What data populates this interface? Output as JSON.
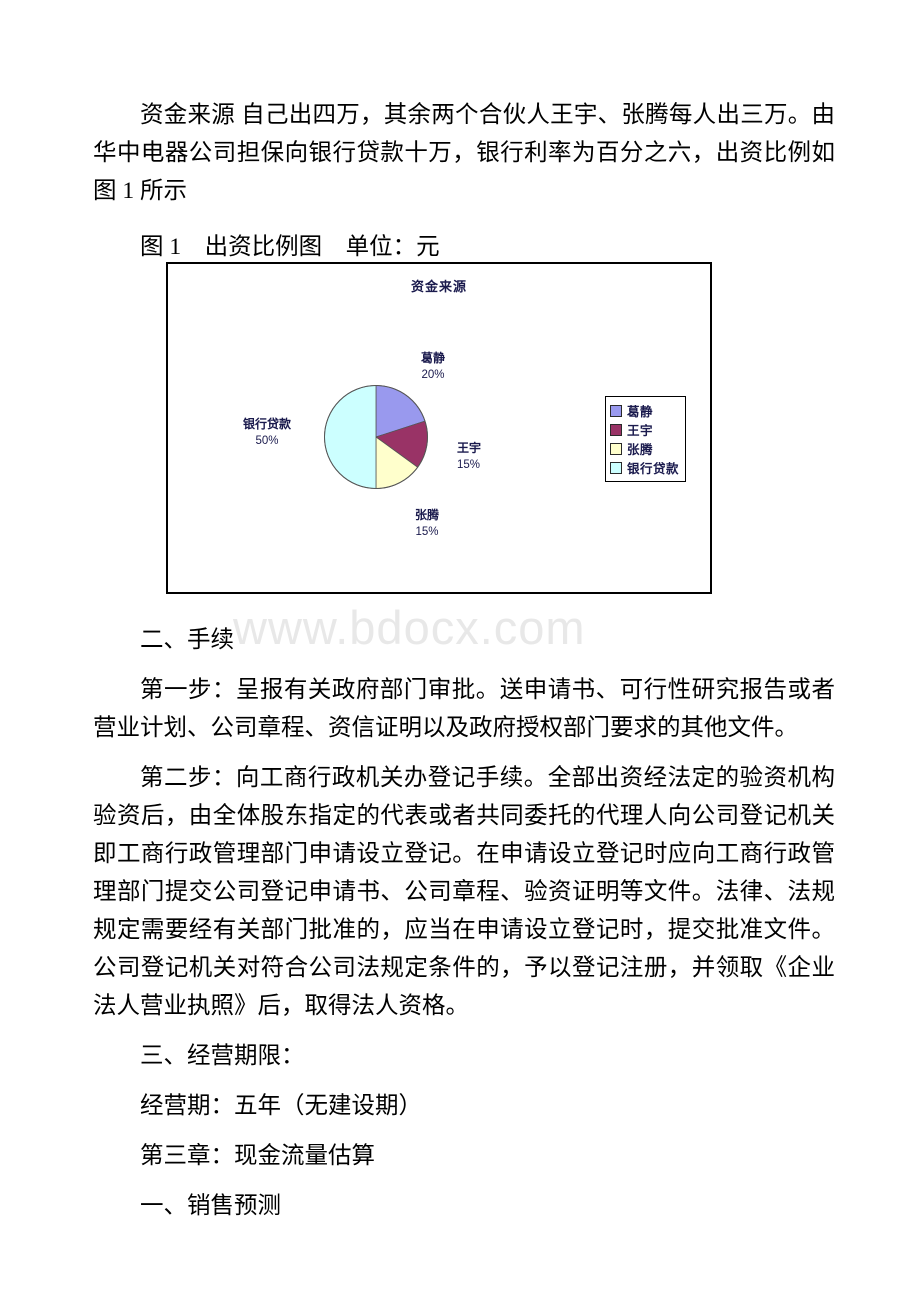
{
  "document": {
    "watermark": "www.bdocx.com",
    "paragraphs": [
      {
        "id": "p-funding-source",
        "text": "资金来源 自己出四万，其余两个合伙人王宇、张腾每人出三万。由华中电器公司担保向银行贷款十万，银行利率为百分之六，出资比例如图 1 所示"
      },
      {
        "id": "p-figure-caption",
        "text": "图 1　出资比例图　单位：元"
      },
      {
        "id": "p-heading-procedures",
        "text": "二、手续"
      },
      {
        "id": "p-step-one",
        "text": "第一步：呈报有关政府部门审批。送申请书、可行性研究报告或者营业计划、公司章程、资信证明以及政府授权部门要求的其他文件。"
      },
      {
        "id": "p-step-two",
        "text": "第二步：向工商行政机关办登记手续。全部出资经法定的验资机构验资后，由全体股东指定的代表或者共同委托的代理人向公司登记机关即工商行政管理部门申请设立登记。在申请设立登记时应向工商行政管理部门提交公司登记申请书、公司章程、验资证明等文件。法律、法规规定需要经有关部门批准的，应当在申请设立登记时，提交批准文件。公司登记机关对符合公司法规定条件的，予以登记注册，并领取《企业法人营业执照》后，取得法人资格。"
      },
      {
        "id": "p-heading-term",
        "text": "三、经营期限："
      },
      {
        "id": "p-term-value",
        "text": "经营期：五年（无建设期）"
      },
      {
        "id": "p-heading-chapter3",
        "text": "第三章：现金流量估算"
      },
      {
        "id": "p-heading-sales",
        "text": "一、销售预测"
      }
    ]
  },
  "chart_data": {
    "type": "pie",
    "title": "资金来源",
    "xlabel": "",
    "ylabel": "",
    "categories": [
      "葛静",
      "王宇",
      "张腾",
      "银行贷款"
    ],
    "values": [
      20,
      15,
      15,
      50
    ],
    "value_labels": [
      "20%",
      "15%",
      "15%",
      "50%"
    ],
    "colors": [
      "#9999ee",
      "#993366",
      "#ffffcc",
      "#ccffff"
    ],
    "legend": {
      "position": "right",
      "entries": [
        {
          "label": "葛静",
          "color": "#9999ee"
        },
        {
          "label": "王宇",
          "color": "#993366"
        },
        {
          "label": "张腾",
          "color": "#ffffcc"
        },
        {
          "label": "银行贷款",
          "color": "#ccffff"
        }
      ]
    },
    "slice_labels": [
      {
        "name": "葛静",
        "percent": "20%"
      },
      {
        "name": "王宇",
        "percent": "15%"
      },
      {
        "name": "张腾",
        "percent": "15%"
      },
      {
        "name": "银行贷款",
        "percent": "50%"
      }
    ],
    "start_angle_deg": 0,
    "direction": "clockwise",
    "grid": false
  }
}
